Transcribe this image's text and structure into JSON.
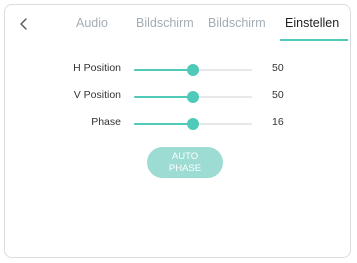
{
  "header": {
    "back_icon": "chevron-left-icon",
    "tabs": [
      {
        "label": "Audio",
        "active": false
      },
      {
        "label": "Bildschirm",
        "active": false
      },
      {
        "label": "Bildschirm",
        "active": false
      },
      {
        "label": "Einstellen",
        "active": true
      }
    ]
  },
  "settings": [
    {
      "label": "H Position",
      "value": "50",
      "level": 0.5
    },
    {
      "label": "V Position",
      "value": "50",
      "level": 0.5
    },
    {
      "label": "Phase",
      "value": "16",
      "level": 0.5
    }
  ],
  "auto_phase_button": {
    "label": "AUTO PHASE"
  },
  "colors": {
    "accent": "#4fc9b8",
    "button_fill": "#9ddcd3",
    "inactive_tab": "#a4acb3"
  }
}
